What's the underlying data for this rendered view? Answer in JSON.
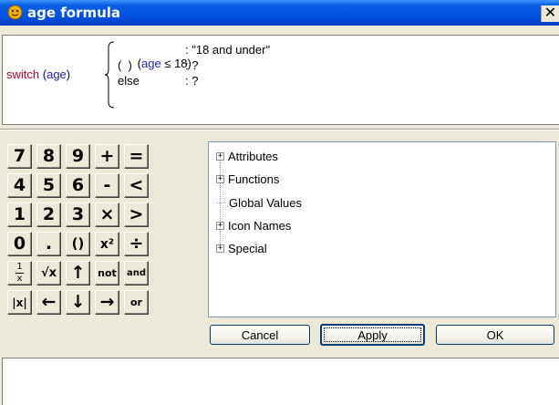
{
  "window": {
    "title": "age formula",
    "close_glyph": "✕"
  },
  "formula": {
    "switch_kw": "switch",
    "open_paren": "(",
    "variable": "age",
    "close_paren": ")",
    "cases": [
      {
        "open": "(",
        "var": "age",
        "op": " ≤ 18",
        "close": ")",
        "result": ": \"18 and under\""
      },
      {
        "open": "(  )",
        "var": "",
        "op": "",
        "close": "",
        "result": ": ?"
      },
      {
        "open": "else",
        "var": "",
        "op": "",
        "close": "",
        "result": ": ?"
      }
    ]
  },
  "keypad": {
    "rows": [
      [
        "7",
        "8",
        "9",
        "+",
        "="
      ],
      [
        "4",
        "5",
        "6",
        "-",
        "<"
      ],
      [
        "1",
        "2",
        "3",
        "×",
        ">"
      ],
      [
        "0",
        ".",
        "()",
        "x²",
        "÷"
      ],
      [
        "1/x",
        "√x",
        "↑",
        "not",
        "and"
      ],
      [
        "|x|",
        "←",
        "↓",
        "→",
        "or"
      ]
    ]
  },
  "tree": {
    "items": [
      {
        "label": "Attributes",
        "expandable": true,
        "expander": "+"
      },
      {
        "label": "Functions",
        "expandable": true,
        "expander": "+"
      },
      {
        "label": "Global Values",
        "expandable": false,
        "expander": ""
      },
      {
        "label": "Icon Names",
        "expandable": true,
        "expander": "+"
      },
      {
        "label": "Special",
        "expandable": true,
        "expander": "+"
      }
    ]
  },
  "buttons": {
    "cancel": "Cancel",
    "apply": "Apply",
    "ok": "OK"
  },
  "status": {
    "text": ""
  },
  "colors": {
    "title_bar": "#0054e3",
    "keyword": "#b8001f",
    "variable": "#1f1fbf"
  }
}
